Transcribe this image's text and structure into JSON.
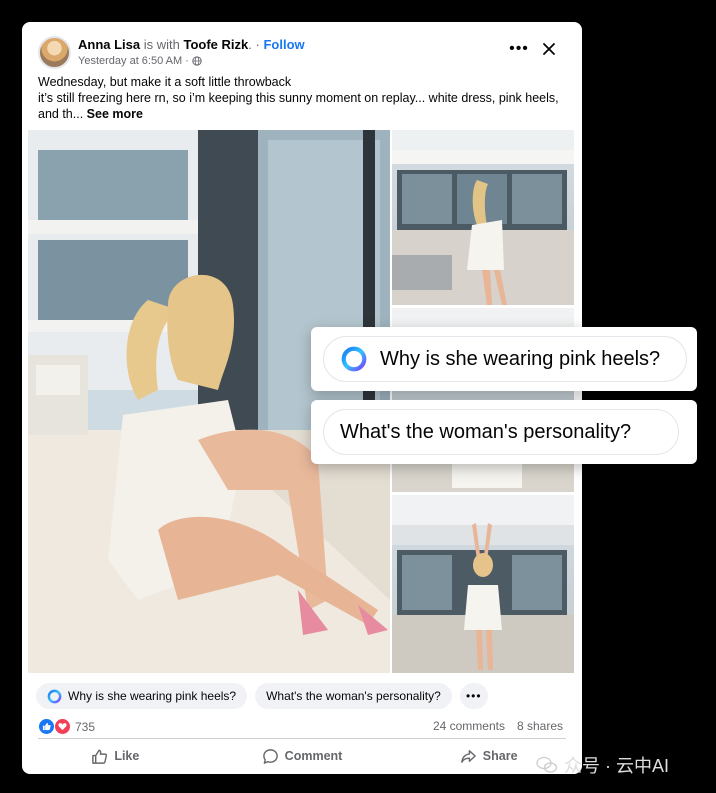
{
  "post": {
    "author": "Anna Lisa",
    "with_text": "is with",
    "tagged": "Toofe Rizk",
    "tagged_suffix": ".",
    "follow_label": "Follow",
    "timestamp": "Yesterday at 6:50 AM",
    "caption_line1": "Wednesday, but make it a soft little throwback",
    "caption_line2": "it’s still freezing here rn, so i’m keeping this sunny moment on replay... white dress, pink heels,",
    "caption_line3": "and th...",
    "see_more": "See more"
  },
  "suggestions": [
    {
      "label": "Why is she wearing pink heels?"
    },
    {
      "label": "What's the woman's personality?"
    }
  ],
  "suggestions_more": "•••",
  "reactions": {
    "count": "735",
    "comments": "24 comments",
    "shares": "8 shares"
  },
  "actions": {
    "like": "Like",
    "comment": "Comment",
    "share": "Share"
  },
  "floating": {
    "q1": "Why is she wearing pink heels?",
    "q2": "What's the woman's personality?"
  },
  "watermark": "众号 · 云中AI",
  "colors": {
    "accent": "#1877f2",
    "love": "#f33e58",
    "muted": "#65676b",
    "chip_bg": "#f0f2f5"
  }
}
